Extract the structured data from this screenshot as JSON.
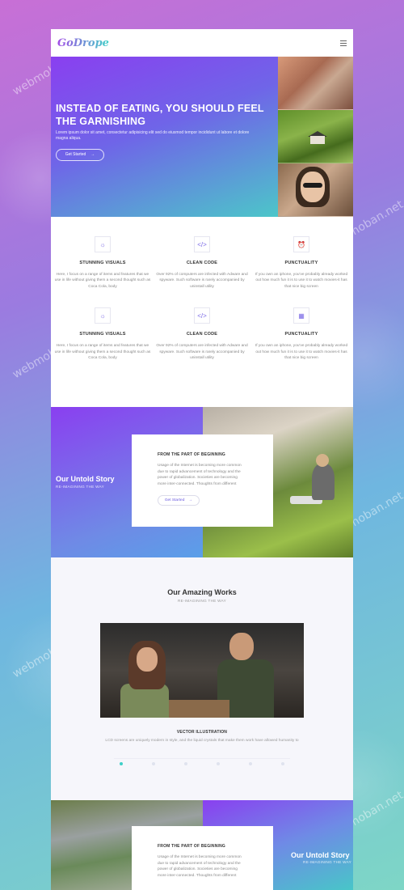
{
  "watermark": "webmoban.net",
  "header": {
    "logo": "GoDrope"
  },
  "hero": {
    "title": "INSTEAD OF EATING, YOU SHOULD FEEL THE GARNISHING",
    "text": "Lorem ipsum dolor sit amet, consectetur adipisicing elit sed do eiusmod tempor incididunt ut labore et dolore magna aliqua.",
    "button": "Get Started",
    "arrow": "→"
  },
  "features": {
    "rows": [
      [
        {
          "icon": "☼",
          "title": "STUNNING VISUALS",
          "text": "Here, I focus on a range of items and features that we use in life without giving them a second thought such as Coca Cola, body"
        },
        {
          "icon": "</>",
          "title": "CLEAN CODE",
          "text": "Over 92% of computers are infected with Adware and spyware. Such software is rarely accompanied by uninstall utility"
        },
        {
          "icon": "⏰",
          "title": "PUNCTUALITY",
          "text": "If you own an iphone, you've probably already worked out how much fun it is to use it to watch movies-it has that nice big screen"
        }
      ],
      [
        {
          "icon": "☼",
          "title": "STUNNING VISUALS",
          "text": "Here, I focus on a range of items and features that we use in life without giving them a second thought such as Coca Cola, body"
        },
        {
          "icon": "</>",
          "title": "CLEAN CODE",
          "text": "Over 92% of computers are infected with Adware and spyware. Such software is rarely accompanied by uninstall utility"
        },
        {
          "icon": "▦",
          "title": "PUNCTUALITY",
          "text": "If you own an iphone, you've probably already worked out how much fun it is to use it to watch movies-it has that nice big screen"
        }
      ]
    ]
  },
  "story": {
    "title": "Our Untold Story",
    "sub": "RE-IMAGINING THE WAY",
    "card_title": "FROM THE PART OF BEGINNING",
    "card_text": "Usage of the Internet is becoming more common due to rapid advancement of technology and the power of globalization. Societies are becoming more inter-connected. Thoughts from different",
    "card_button": "Get Started",
    "arrow": "→"
  },
  "works": {
    "title": "Our Amazing Works",
    "sub": "RE-IMAGINING THE WAY",
    "caption": "VECTOR ILLUSTRATION",
    "text": "LCD screens are uniquely modern in style, and the liquid crystals that make them work have allowed humanity to",
    "dots": 6,
    "active_dot": 0
  },
  "story2": {
    "title": "Our Untold Story",
    "sub": "RE-IMAGINING THE WAY",
    "card_title": "FROM THE PART OF BEGINNING",
    "card_text": "Usage of the Internet is becoming more common due to rapid advancement of technology and the power of globalization. Societies are becoming more inter-connected. Thoughts from different"
  }
}
